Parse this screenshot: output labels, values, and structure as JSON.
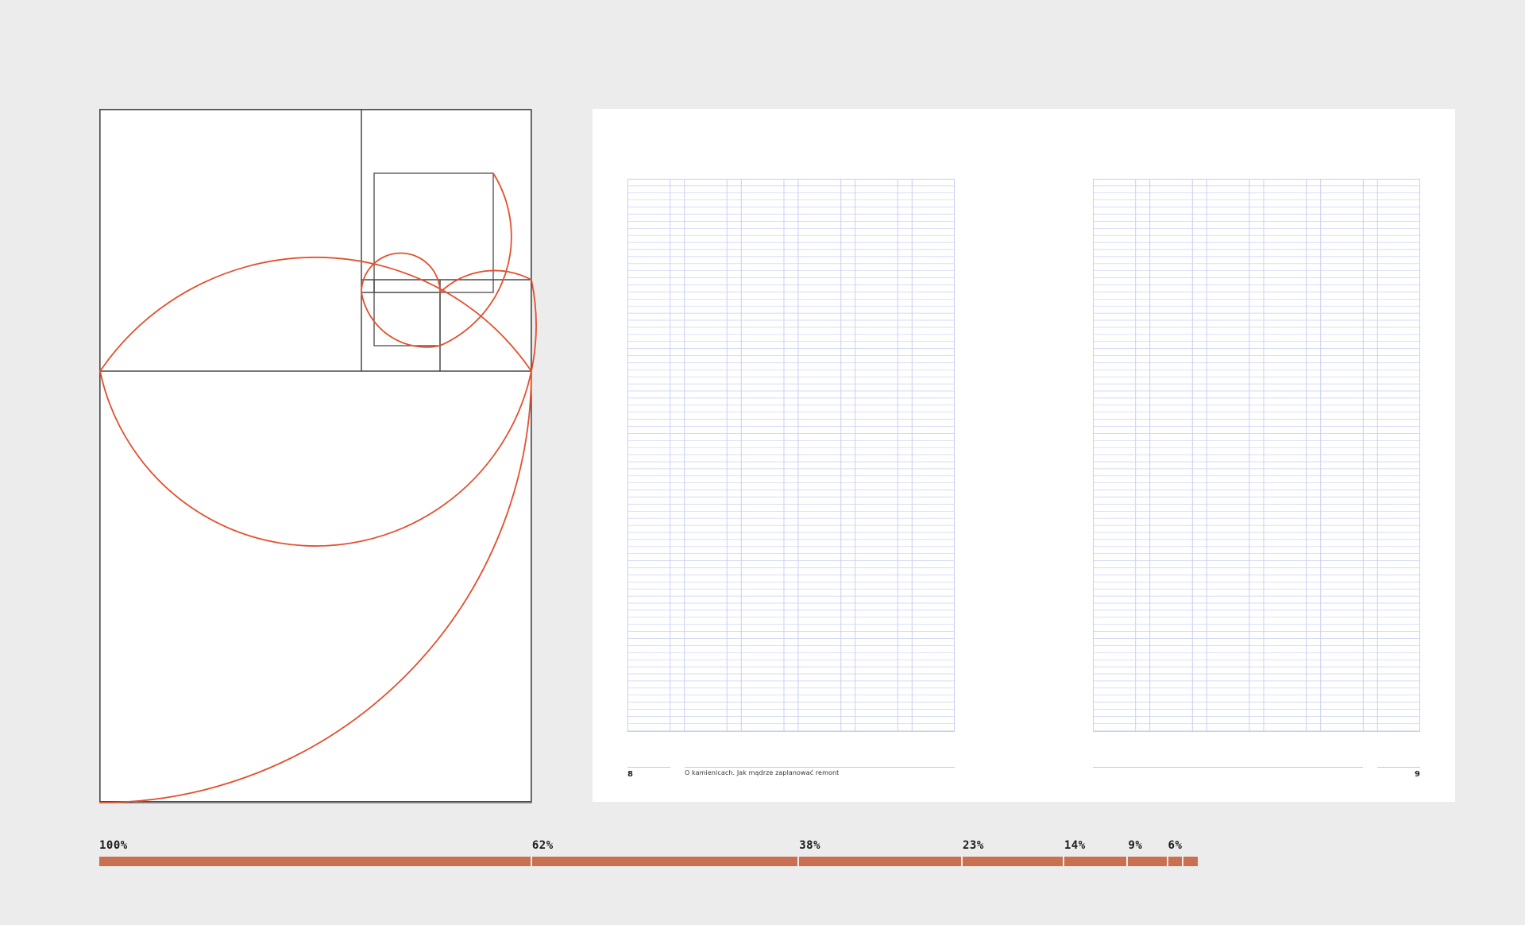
{
  "colors": {
    "background": "#ececec",
    "spiral": "#e2502e",
    "construction_lines": "#4a4a4a",
    "grid_lines": "#c9cff3",
    "scale_bar": "#c8704f"
  },
  "golden_diagram": {
    "description_label": ""
  },
  "spread": {
    "left_page": {
      "folio": "8",
      "running_head": "O kamienicach. Jak mądrze zaplanować remont"
    },
    "right_page": {
      "folio": "9"
    }
  },
  "proportion_scale": {
    "labels": [
      "100%",
      "62%",
      "38%",
      "23%",
      "14%",
      "9%",
      "6%"
    ]
  }
}
